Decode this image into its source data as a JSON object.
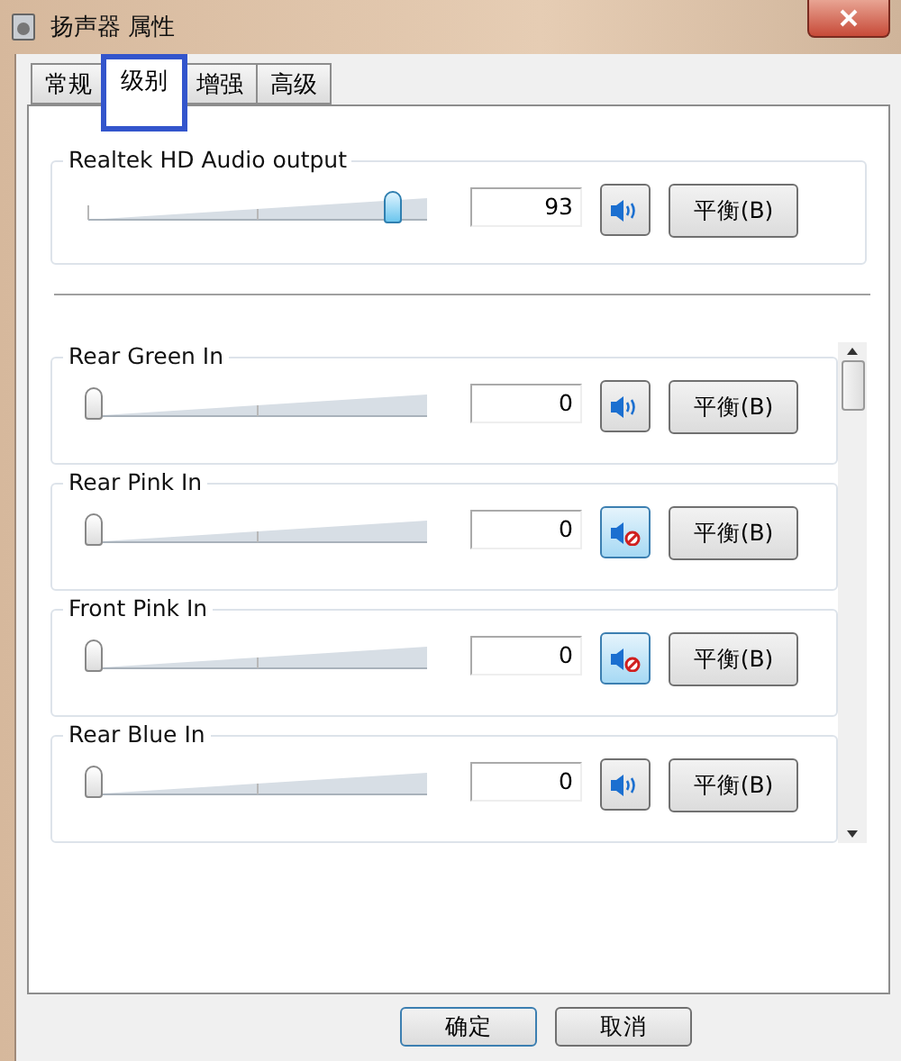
{
  "window": {
    "title": "扬声器 属性"
  },
  "tabs": [
    {
      "label": "常规",
      "selected": false,
      "highlighted": false
    },
    {
      "label": "级别",
      "selected": true,
      "highlighted": true
    },
    {
      "label": "增强",
      "selected": false,
      "highlighted": false
    },
    {
      "label": "高级",
      "selected": false,
      "highlighted": false
    }
  ],
  "output": {
    "name": "Realtek HD Audio output",
    "level": 0.93,
    "reading": "93",
    "muted": false,
    "balance": "平衡(B)"
  },
  "inputs": [
    {
      "name": "Rear Green In",
      "level": 0,
      "reading": "0",
      "muted": false,
      "balance": "平衡(B)"
    },
    {
      "name": "Rear Pink In",
      "level": 0,
      "reading": "0",
      "muted": true,
      "balance": "平衡(B)"
    },
    {
      "name": "Front Pink In",
      "level": 0,
      "reading": "0",
      "muted": true,
      "balance": "平衡(B)"
    },
    {
      "name": "Rear Blue In",
      "level": 0,
      "reading": "0",
      "muted": false,
      "balance": "平衡(B)"
    }
  ],
  "buttons": [
    {
      "label": "确定",
      "selected": true
    },
    {
      "label": "取消",
      "selected": false
    }
  ]
}
